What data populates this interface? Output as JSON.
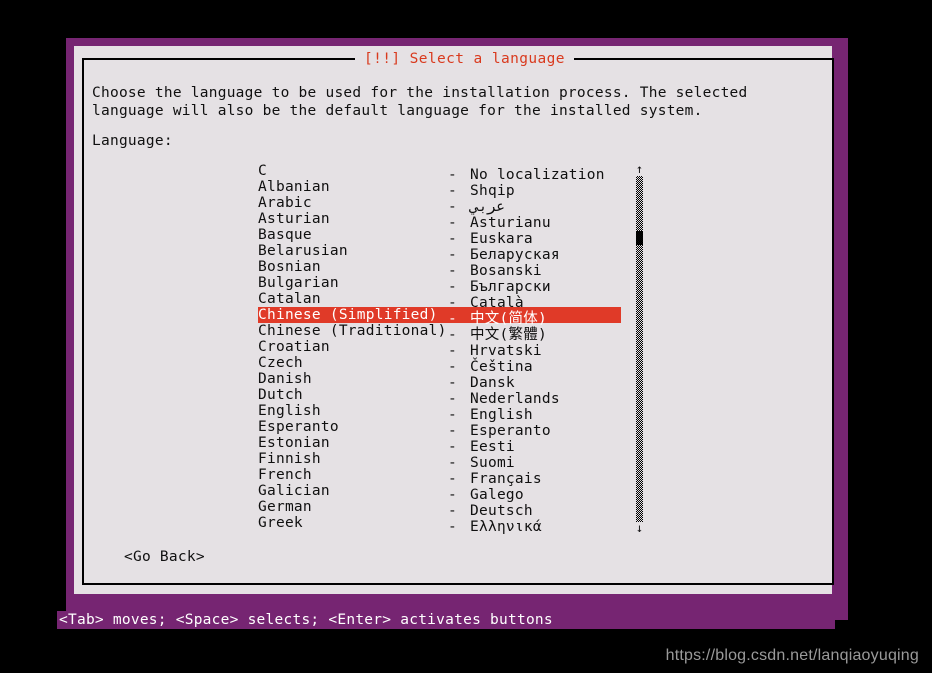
{
  "window": {
    "title": "[!!] Select a language",
    "frame_color": "#762572",
    "panel_color": "#e5e1e4",
    "title_color": "#d93a1e",
    "highlight_color": "#e03a28"
  },
  "dialog": {
    "body_text": "Choose the language to be used for the installation process. The selected language will also be the default language for the installed system.",
    "field_label": "Language:",
    "go_back_label": "<Go Back>"
  },
  "scrollbar": {
    "up_arrow": "↑",
    "down_arrow": "↓"
  },
  "languages": [
    {
      "english": "C",
      "dash": "-",
      "native": "No localization",
      "selected": false
    },
    {
      "english": "Albanian",
      "dash": "-",
      "native": "Shqip",
      "selected": false
    },
    {
      "english": "Arabic",
      "dash": "-",
      "native": "عربي",
      "selected": false
    },
    {
      "english": "Asturian",
      "dash": "-",
      "native": "Asturianu",
      "selected": false
    },
    {
      "english": "Basque",
      "dash": "-",
      "native": "Euskara",
      "selected": false
    },
    {
      "english": "Belarusian",
      "dash": "-",
      "native": "Беларуская",
      "selected": false
    },
    {
      "english": "Bosnian",
      "dash": "-",
      "native": "Bosanski",
      "selected": false
    },
    {
      "english": "Bulgarian",
      "dash": "-",
      "native": "Български",
      "selected": false
    },
    {
      "english": "Catalan",
      "dash": "-",
      "native": "Català",
      "selected": false
    },
    {
      "english": "Chinese (Simplified)",
      "dash": "-",
      "native": "中文(简体)",
      "selected": true
    },
    {
      "english": "Chinese (Traditional)",
      "dash": "-",
      "native": "中文(繁體)",
      "selected": false
    },
    {
      "english": "Croatian",
      "dash": "-",
      "native": "Hrvatski",
      "selected": false
    },
    {
      "english": "Czech",
      "dash": "-",
      "native": "Čeština",
      "selected": false
    },
    {
      "english": "Danish",
      "dash": "-",
      "native": "Dansk",
      "selected": false
    },
    {
      "english": "Dutch",
      "dash": "-",
      "native": "Nederlands",
      "selected": false
    },
    {
      "english": "English",
      "dash": "-",
      "native": "English",
      "selected": false
    },
    {
      "english": "Esperanto",
      "dash": "-",
      "native": "Esperanto",
      "selected": false
    },
    {
      "english": "Estonian",
      "dash": "-",
      "native": "Eesti",
      "selected": false
    },
    {
      "english": "Finnish",
      "dash": "-",
      "native": "Suomi",
      "selected": false
    },
    {
      "english": "French",
      "dash": "-",
      "native": "Français",
      "selected": false
    },
    {
      "english": "Galician",
      "dash": "-",
      "native": "Galego",
      "selected": false
    },
    {
      "english": "German",
      "dash": "-",
      "native": "Deutsch",
      "selected": false
    },
    {
      "english": "Greek",
      "dash": "-",
      "native": "Ελληνικά",
      "selected": false
    }
  ],
  "help_bar": {
    "text": "<Tab> moves; <Space> selects; <Enter> activates buttons"
  },
  "watermark": {
    "text": "https://blog.csdn.net/lanqiaoyuqing"
  }
}
